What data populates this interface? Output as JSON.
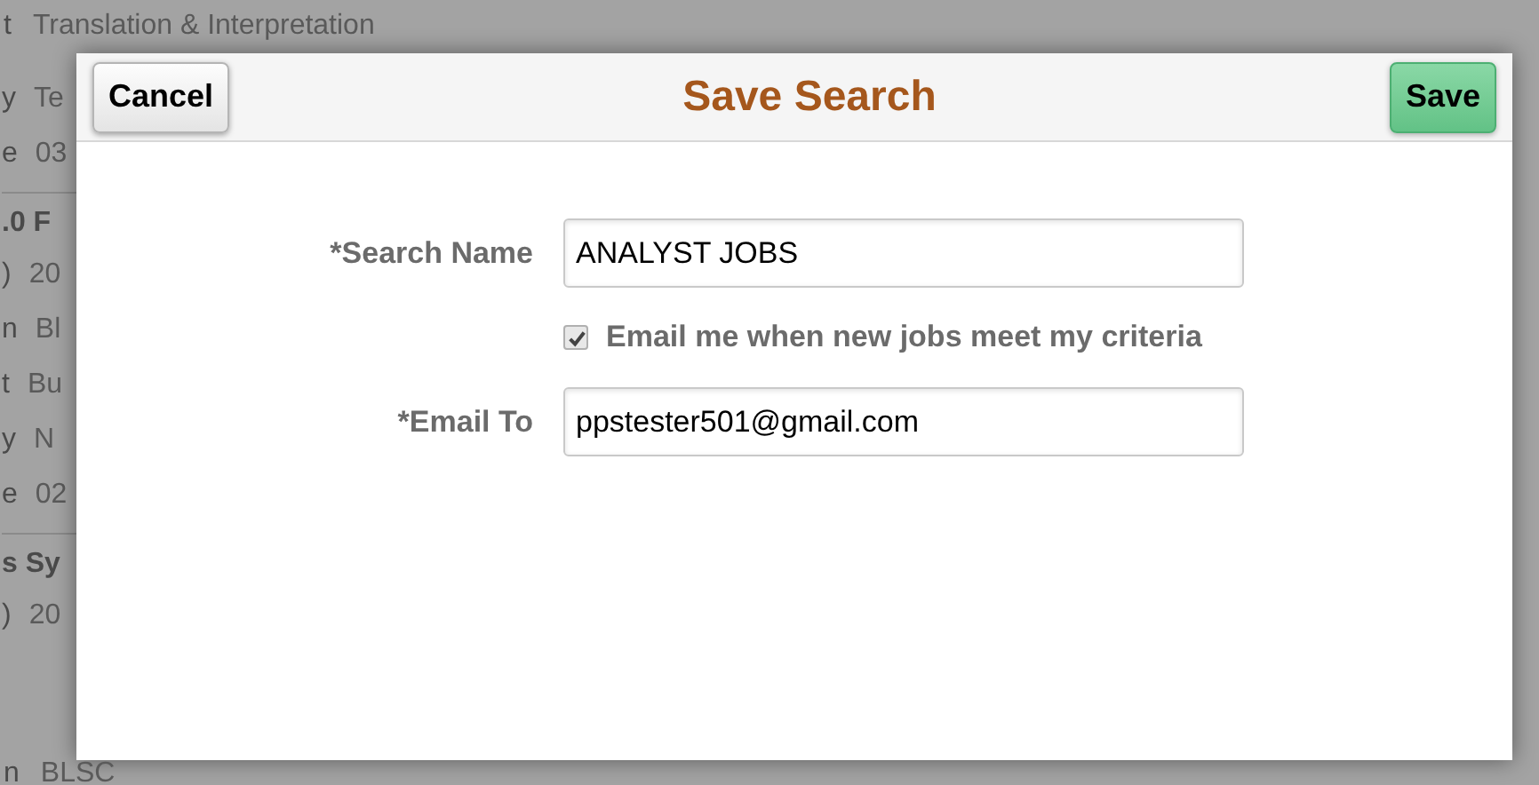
{
  "background": {
    "top_row": {
      "label": "t",
      "value": "Translation & Interpretation"
    },
    "rows": [
      {
        "kind": "field",
        "label": "y",
        "value": "Te"
      },
      {
        "kind": "field",
        "label": "e",
        "value": "03"
      },
      {
        "kind": "heading",
        "value": ".0 F"
      },
      {
        "kind": "field",
        "label": ")",
        "value": "20"
      },
      {
        "kind": "field",
        "label": "n",
        "value": "Bl"
      },
      {
        "kind": "field",
        "label": "t",
        "value": "Bu"
      },
      {
        "kind": "field",
        "label": "y",
        "value": "N"
      },
      {
        "kind": "field",
        "label": "e",
        "value": "02"
      },
      {
        "kind": "heading",
        "value": "s Sy"
      },
      {
        "kind": "field",
        "label": ")",
        "value": "20"
      }
    ],
    "bottom_row": {
      "label": "n",
      "value": "BLSC"
    }
  },
  "dialog": {
    "title": "Save Search",
    "cancel": "Cancel",
    "save": "Save",
    "search_name": {
      "label": "*Search Name",
      "value": "ANALYST JOBS"
    },
    "email_option": {
      "label": "Email me when new jobs meet my criteria",
      "checked": true
    },
    "email_to": {
      "label": "*Email To",
      "value": "ppstester501@gmail.com"
    }
  }
}
